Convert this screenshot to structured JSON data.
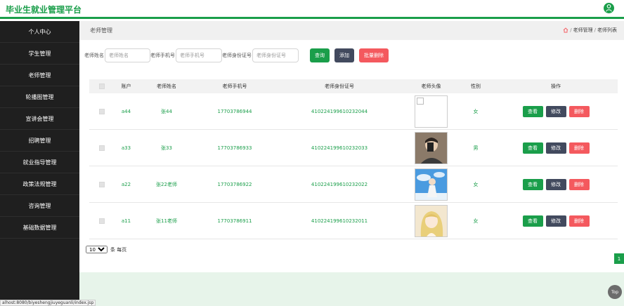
{
  "app": {
    "title": "毕业生就业管理平台"
  },
  "sidebar": {
    "items": [
      {
        "label": "个人中心"
      },
      {
        "label": "学生管理"
      },
      {
        "label": "老师管理"
      },
      {
        "label": "轮播图管理"
      },
      {
        "label": "宣讲会管理"
      },
      {
        "label": "招聘管理"
      },
      {
        "label": "就业指导管理"
      },
      {
        "label": "政策法规管理"
      },
      {
        "label": "咨询管理"
      },
      {
        "label": "基础数据管理"
      }
    ]
  },
  "header": {
    "title": "老师管理",
    "breadcrumb": {
      "level1": "老师管理",
      "level2": "老师列表",
      "sep": "/"
    }
  },
  "search": {
    "name_label": "老师姓名",
    "name_placeholder": "老师姓名",
    "phone_label": "老师手机号",
    "phone_placeholder": "老师手机号",
    "id_label": "老师身份证号",
    "id_placeholder": "老师身份证号",
    "query_label": "查询",
    "add_label": "添加",
    "batch_delete_label": "批量删除"
  },
  "table": {
    "headers": {
      "account": "账户",
      "name": "老师姓名",
      "phone": "老师手机号",
      "id_number": "老师身份证号",
      "avatar": "老师头像",
      "gender": "性别",
      "ops": "操作"
    },
    "rows": [
      {
        "account": "a44",
        "name": "张44",
        "phone": "17703786944",
        "id_number": "410224199610232044",
        "gender": "女"
      },
      {
        "account": "a33",
        "name": "张33",
        "phone": "17703786933",
        "id_number": "410224199610232033",
        "gender": "男"
      },
      {
        "account": "a22",
        "name": "张22老师",
        "phone": "17703786922",
        "id_number": "410224199610232022",
        "gender": "女"
      },
      {
        "account": "a11",
        "name": "张11老师",
        "phone": "17703786911",
        "id_number": "410224199610232011",
        "gender": "女"
      }
    ],
    "actions": {
      "view": "查看",
      "edit": "修改",
      "delete": "删除"
    }
  },
  "pager": {
    "page_size": "10",
    "per_page_label": "条 每页",
    "current_page": "1"
  },
  "to_top": "Top",
  "status_url": "alhost:8080/biyeshengjiuyeguanli/index.jsp",
  "colors": {
    "accent": "#1a9e4a",
    "dark": "#424a5e",
    "danger": "#f4595e",
    "sidebar": "#1f1f1f"
  }
}
